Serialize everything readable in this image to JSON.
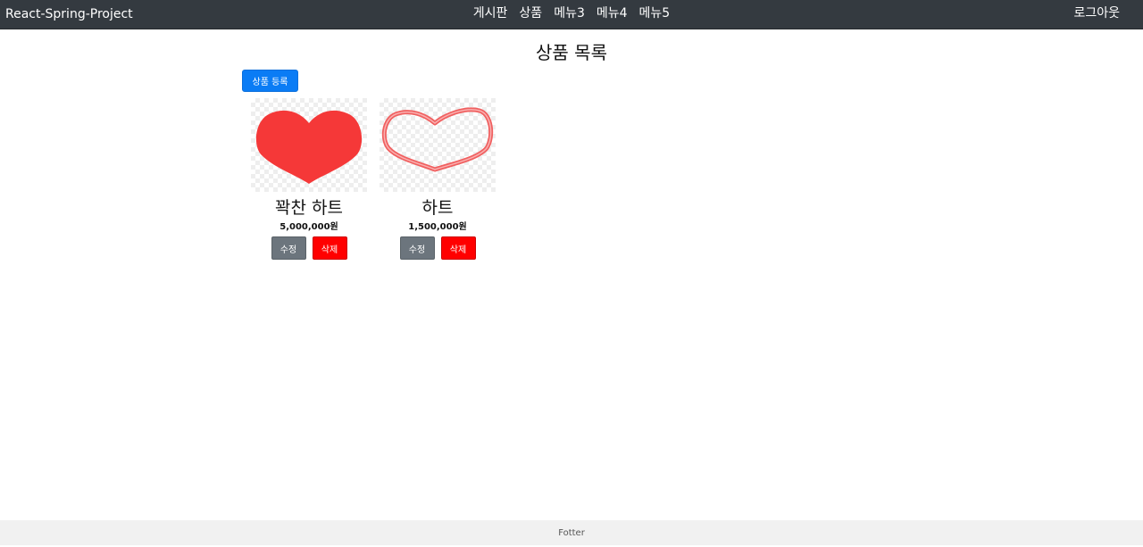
{
  "navbar": {
    "brand": "React-Spring-Project",
    "menu": [
      {
        "label": "게시판"
      },
      {
        "label": "상품"
      },
      {
        "label": "메뉴3"
      },
      {
        "label": "메뉴4"
      },
      {
        "label": "메뉴5"
      }
    ],
    "logout_label": "로그아웃"
  },
  "main": {
    "title": "상품 목록",
    "register_label": "상품 등록",
    "products": [
      {
        "name": "꽉찬 하트",
        "price": "5,000,000원",
        "image": "filled-heart",
        "edit_label": "수정",
        "delete_label": "삭제"
      },
      {
        "name": "하트",
        "price": "1,500,000원",
        "image": "outline-heart",
        "edit_label": "수정",
        "delete_label": "삭제"
      }
    ]
  },
  "footer": {
    "text": "Fotter"
  },
  "colors": {
    "navbar_bg": "#343a40",
    "primary": "#0a7cf5",
    "secondary": "#6c757d",
    "danger": "#ff0000",
    "heart_fill": "#f53838",
    "heart_outline": "#f06060",
    "footer_bg": "#f1f1f1"
  }
}
